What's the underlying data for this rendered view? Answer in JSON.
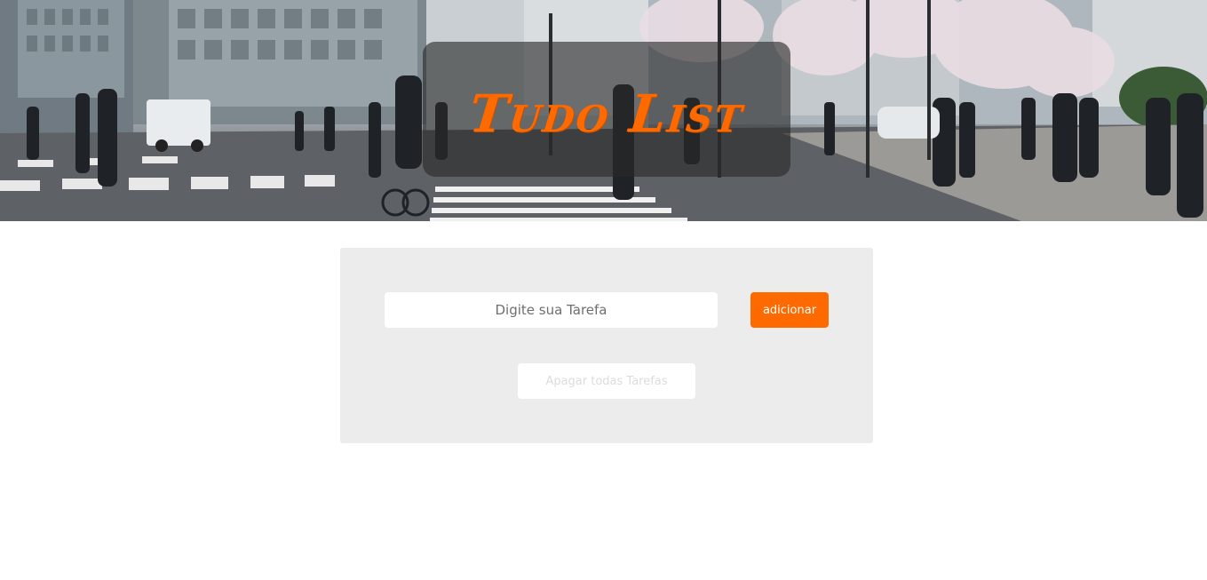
{
  "header": {
    "title": "Tudo List",
    "title_color": "#ff6a00",
    "background_image": "city-street-crosswalk-photo"
  },
  "form": {
    "task_placeholder": "Digite sua Tarefa",
    "task_value": "",
    "add_label": "adicionar",
    "add_color": "#ff6a00",
    "clear_all_label": "Apagar todas Tarefas"
  },
  "tasks": []
}
